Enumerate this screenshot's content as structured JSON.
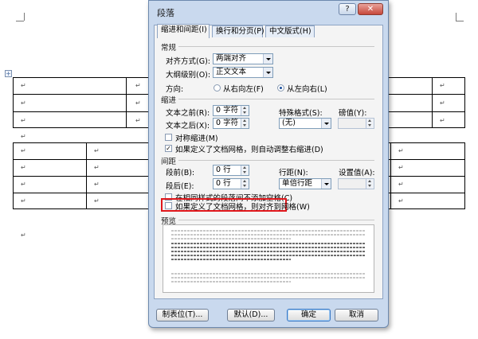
{
  "dialog": {
    "title": "段落",
    "help_label": "?",
    "close_label": "✕",
    "tabs": [
      "缩进和间距(I)",
      "换行和分页(P)",
      "中文版式(H)"
    ],
    "general": {
      "section": "常规",
      "alignment_label": "对齐方式(G):",
      "alignment_value": "两端对齐",
      "outline_label": "大纲级别(O):",
      "outline_value": "正文文本",
      "direction_label": "方向:",
      "rtl_label": "从右向左(F)",
      "ltr_label": "从左向右(L)",
      "direction_selected": "ltr"
    },
    "indent": {
      "section": "缩进",
      "before_label": "文本之前(R):",
      "before_value": "0 字符",
      "after_label": "文本之后(X):",
      "after_value": "0 字符",
      "special_label": "特殊格式(S):",
      "special_value": "(无)",
      "measure_label": "磅值(Y):",
      "symmetric_label": "对称缩进(M)",
      "symmetric_checked": false,
      "auto_adjust_label": "如果定义了文档网格，则自动调整右缩进(D)",
      "auto_adjust_checked": true
    },
    "spacing": {
      "section": "间距",
      "before_label": "段前(B):",
      "before_value": "0 行",
      "after_label": "段后(E):",
      "after_value": "0 行",
      "line_label": "行距(N):",
      "line_value": "单倍行距",
      "at_label": "设置值(A):",
      "no_space_label": "在相同样式的段落间不添加空格(C)",
      "no_space_checked": false,
      "snap_grid_label": "如果定义了文档网格，则对齐到网格(W)",
      "snap_grid_checked": false
    },
    "preview": {
      "section": "预览"
    },
    "buttons": {
      "tabs": "制表位(T)...",
      "default": "默认(D)...",
      "ok": "确定",
      "cancel": "取消"
    }
  },
  "document": {
    "paragraph_mark": "↵",
    "anchor": "+"
  },
  "colors": {
    "highlight_box": "#e0161b",
    "dialog_frame": "#c9d9ee"
  }
}
